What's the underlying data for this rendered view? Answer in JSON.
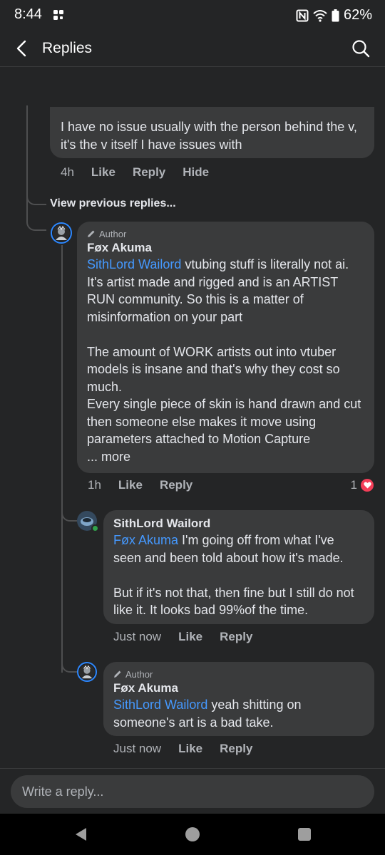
{
  "status": {
    "time": "8:44",
    "battery": "62%"
  },
  "appbar": {
    "title": "Replies"
  },
  "thread": {
    "top_comment": {
      "text": "I have no issue usually with the person behind the v, it's the v itself I have issues with",
      "time": "4h",
      "like": "Like",
      "reply": "Reply",
      "hide": "Hide"
    },
    "view_previous": "View previous replies...",
    "author_reply": {
      "badge": "Author",
      "name": "Føx Akuma",
      "mention": "SithLord Wailord",
      "text1": " vtubing stuff is literally not ai. It's artist made and rigged and is an ARTIST RUN community. So this is a matter of misinformation on your part",
      "text2": "The amount of WORK artists out into vtuber models is insane and that's why they cost so much.",
      "text3": "Every single piece of skin is hand drawn and cut then someone else makes it move using parameters attached to Motion Capture",
      "more": "... more",
      "time": "1h",
      "like": "Like",
      "reply": "Reply",
      "reactions": "1"
    },
    "sith_reply": {
      "name": "SithLord Wailord",
      "mention": "Føx Akuma",
      "text1": " I'm going off from what I've seen and been told about how it's made.",
      "text2": "But if it's not that, then fine but I still do not like it. It looks bad 99%of the time.",
      "time": "Just now",
      "like": "Like",
      "reply": "Reply"
    },
    "fox_reply2": {
      "badge": "Author",
      "name": "Føx Akuma",
      "mention": "SithLord Wailord",
      "text": " yeah shitting on someone's art is a bad take.",
      "time": "Just now",
      "like": "Like",
      "reply": "Reply"
    }
  },
  "composer": {
    "placeholder": "Write a reply..."
  },
  "colors": {
    "background": "#242526",
    "bubble": "#3a3b3c",
    "mention": "#4599ff",
    "heart": "#f33e58",
    "online": "#31a24c"
  }
}
